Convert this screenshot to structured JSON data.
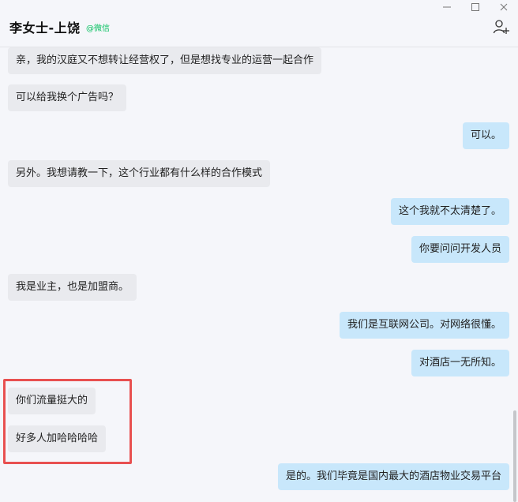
{
  "header": {
    "contact_name": "李女士-上饶",
    "contact_tag": "@微信"
  },
  "icons": {
    "minimize": "minimize-icon",
    "maximize": "maximize-icon",
    "close": "close-icon",
    "add_user": "add-user-icon"
  },
  "colors": {
    "incoming_bubble": "#e9eaee",
    "outgoing_bubble": "#c8e7fb",
    "tag_green": "#07c160",
    "highlight_red": "#e85050"
  },
  "messages": [
    {
      "side": "in",
      "text": "亲，我的汉庭又不想转让经营权了，但是想找专业的运营一起合作"
    },
    {
      "side": "in",
      "text": "可以给我换个广告吗？"
    },
    {
      "side": "out",
      "text": "可以。"
    },
    {
      "side": "in",
      "text": "另外。我想请教一下，这个行业都有什么样的合作模式"
    },
    {
      "side": "out",
      "text": "这个我就不太清楚了。"
    },
    {
      "side": "out",
      "text": "你要问问开发人员"
    },
    {
      "side": "in",
      "text": "我是业主，也是加盟商。"
    },
    {
      "side": "out",
      "text": "我们是互联网公司。对网络很懂。"
    },
    {
      "side": "out",
      "text": "对酒店一无所知。"
    },
    {
      "side": "in",
      "text": "你们流量挺大的"
    },
    {
      "side": "in",
      "text": "好多人加哈哈哈哈"
    },
    {
      "side": "out",
      "text": "是的。我们毕竟是国内最大的酒店物业交易平台"
    }
  ]
}
